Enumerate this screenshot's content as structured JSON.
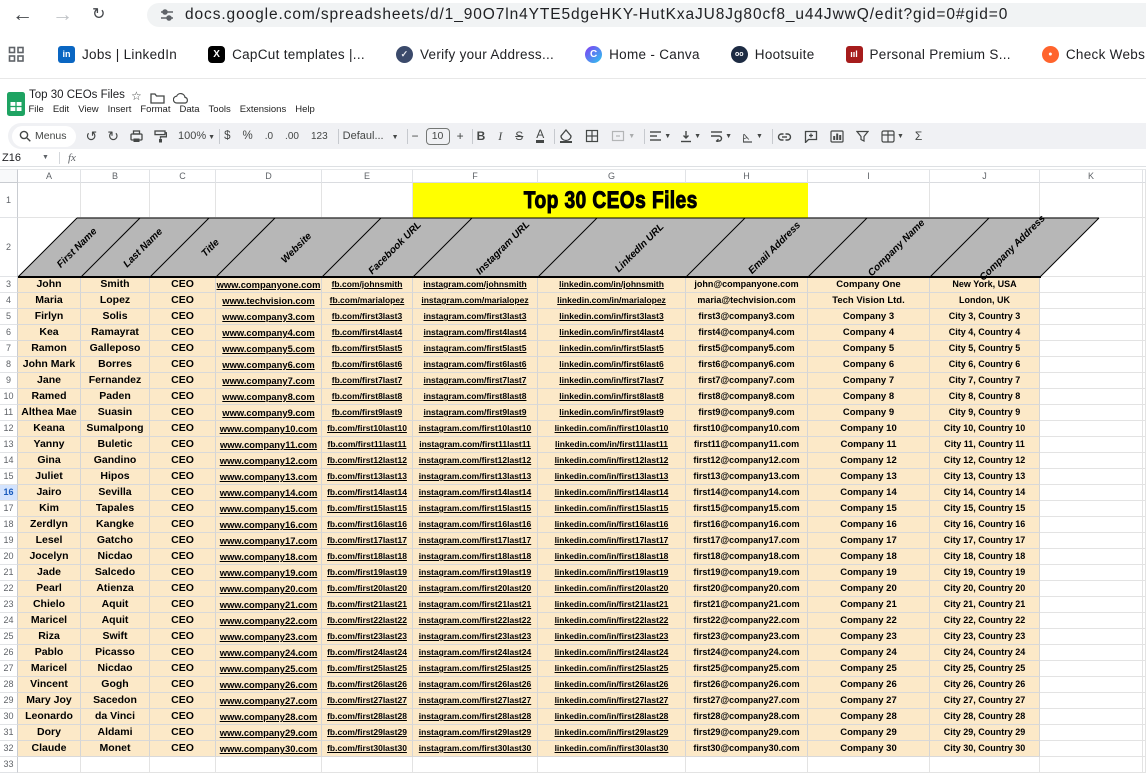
{
  "browser": {
    "url": "docs.google.com/spreadsheets/d/1_90O7ln4YTE5dgeHKY-HutKxaJU8Jg80cf8_u44JwwQ/edit?gid=0#gid=0",
    "bookmarks": [
      {
        "label": "Jobs | LinkedIn",
        "icon": "linkedin-icon",
        "glyph": "in",
        "bg": "#0a66c2",
        "fg": "#ffffff",
        "shape": "3px",
        "fs": "9px"
      },
      {
        "label": "CapCut templates |...",
        "icon": "capcut-icon",
        "glyph": "X",
        "bg": "#000000",
        "fg": "#ffffff",
        "shape": "4px",
        "fs": "10px"
      },
      {
        "label": "Verify your Address...",
        "icon": "verify-icon",
        "glyph": "✓",
        "bg": "#3b4a6b",
        "fg": "#e8eaf0",
        "shape": "50%",
        "fs": "9px"
      },
      {
        "label": "Home - Canva",
        "icon": "canva-icon",
        "glyph": "C",
        "bg": "linear-gradient(135deg,#823af3,#2bc9ee)",
        "fg": "#ffffff",
        "shape": "50%",
        "fs": "10px"
      },
      {
        "label": "Hootsuite",
        "icon": "hootsuite-icon",
        "glyph": "oo",
        "bg": "#1d2b43",
        "fg": "#ffffff",
        "shape": "50%",
        "fs": "7px"
      },
      {
        "label": "Personal Premium S...",
        "icon": "bars-icon",
        "glyph": "ııl",
        "bg": "#a61c1c",
        "fg": "#ffffff",
        "shape": "3px",
        "fs": "9px"
      },
      {
        "label": "Check Webs...",
        "icon": "semrush-icon",
        "glyph": "●",
        "bg": "#ff642d",
        "fg": "#ffffff",
        "shape": "50%",
        "fs": "7px"
      }
    ]
  },
  "sheets": {
    "doc_title": "Top 30 CEOs Files",
    "menu": [
      "File",
      "Edit",
      "View",
      "Insert",
      "Format",
      "Data",
      "Tools",
      "Extensions",
      "Help"
    ],
    "toolbar": {
      "menus": "Menus",
      "zoom": "100%",
      "currency": "$",
      "percent": "%",
      "dec0": ".0",
      "dec00": ".00",
      "n123": "123",
      "font": "Defaul...",
      "minus": "−",
      "size": "10",
      "plus": "+",
      "bold": "B",
      "italic": "I",
      "strike": "S",
      "color": "A",
      "sigma": "Σ"
    },
    "name_box": "Z16",
    "fx": "fx"
  },
  "sheet": {
    "col_letters": [
      "A",
      "B",
      "C",
      "D",
      "E",
      "F",
      "G",
      "H",
      "I",
      "J",
      "K"
    ],
    "row_numbers": [
      1,
      2,
      3,
      4,
      5,
      6,
      7,
      8,
      9,
      10,
      11,
      12,
      13,
      14,
      15,
      16,
      17,
      18,
      19,
      20,
      21,
      22,
      23,
      24,
      25,
      26,
      27,
      28,
      29,
      30,
      31,
      32,
      33
    ],
    "title_cell": "Top 30 CEOs Files",
    "headers": [
      "First Name",
      "Last Name",
      "Title",
      "Website",
      "Facebook URL",
      "Instagram URL",
      "LinkedIn URL",
      "Email Address",
      "Company Name",
      "Company Address"
    ],
    "selected_row": 16,
    "rows": [
      [
        "John",
        "Smith",
        "CEO",
        "www.companyone.com",
        "fb.com/johnsmith",
        "instagram.com/johnsmith",
        "linkedin.com/in/johnsmith",
        "john@companyone.com",
        "Company One",
        "New York, USA"
      ],
      [
        "Maria",
        "Lopez",
        "CEO",
        "www.techvision.com",
        "fb.com/marialopez",
        "instagram.com/marialopez",
        "linkedin.com/in/marialopez",
        "maria@techvision.com",
        "Tech Vision Ltd.",
        "London, UK"
      ],
      [
        "Firlyn",
        "Solis",
        "CEO",
        "www.company3.com",
        "fb.com/first3last3",
        "instagram.com/first3last3",
        "linkedin.com/in/first3last3",
        "first3@company3.com",
        "Company 3",
        "City 3, Country 3"
      ],
      [
        "Kea",
        "Ramayrat",
        "CEO",
        "www.company4.com",
        "fb.com/first4last4",
        "instagram.com/first4last4",
        "linkedin.com/in/first4last4",
        "first4@company4.com",
        "Company 4",
        "City 4, Country 4"
      ],
      [
        "Ramon",
        "Galleposo",
        "CEO",
        "www.company5.com",
        "fb.com/first5last5",
        "instagram.com/first5last5",
        "linkedin.com/in/first5last5",
        "first5@company5.com",
        "Company 5",
        "City 5, Country 5"
      ],
      [
        "John Mark",
        "Borres",
        "CEO",
        "www.company6.com",
        "fb.com/first6last6",
        "instagram.com/first6last6",
        "linkedin.com/in/first6last6",
        "first6@company6.com",
        "Company 6",
        "City 6, Country 6"
      ],
      [
        "Jane",
        "Fernandez",
        "CEO",
        "www.company7.com",
        "fb.com/first7last7",
        "instagram.com/first7last7",
        "linkedin.com/in/first7last7",
        "first7@company7.com",
        "Company 7",
        "City 7, Country 7"
      ],
      [
        "Ramed",
        "Paden",
        "CEO",
        "www.company8.com",
        "fb.com/first8last8",
        "instagram.com/first8last8",
        "linkedin.com/in/first8last8",
        "first8@company8.com",
        "Company 8",
        "City 8, Country 8"
      ],
      [
        "Althea Mae",
        "Suasin",
        "CEO",
        "www.company9.com",
        "fb.com/first9last9",
        "instagram.com/first9last9",
        "linkedin.com/in/first9last9",
        "first9@company9.com",
        "Company 9",
        "City 9, Country 9"
      ],
      [
        "Keana",
        "Sumalpong",
        "CEO",
        "www.company10.com",
        "fb.com/first10last10",
        "instagram.com/first10last10",
        "linkedin.com/in/first10last10",
        "first10@company10.com",
        "Company 10",
        "City 10, Country 10"
      ],
      [
        "Yanny",
        "Buletic",
        "CEO",
        "www.company11.com",
        "fb.com/first11last11",
        "instagram.com/first11last11",
        "linkedin.com/in/first11last11",
        "first11@company11.com",
        "Company 11",
        "City 11, Country 11"
      ],
      [
        "Gina",
        "Gandino",
        "CEO",
        "www.company12.com",
        "fb.com/first12last12",
        "instagram.com/first12last12",
        "linkedin.com/in/first12last12",
        "first12@company12.com",
        "Company 12",
        "City 12, Country 12"
      ],
      [
        "Juliet",
        "Hipos",
        "CEO",
        "www.company13.com",
        "fb.com/first13last13",
        "instagram.com/first13last13",
        "linkedin.com/in/first13last13",
        "first13@company13.com",
        "Company 13",
        "City 13, Country 13"
      ],
      [
        "Jairo",
        "Sevilla",
        "CEO",
        "www.company14.com",
        "fb.com/first14last14",
        "instagram.com/first14last14",
        "linkedin.com/in/first14last14",
        "first14@company14.com",
        "Company 14",
        "City 14, Country 14"
      ],
      [
        "Kim",
        "Tapales",
        "CEO",
        "www.company15.com",
        "fb.com/first15last15",
        "instagram.com/first15last15",
        "linkedin.com/in/first15last15",
        "first15@company15.com",
        "Company 15",
        "City 15, Country 15"
      ],
      [
        "Zerdlyn",
        "Kangke",
        "CEO",
        "www.company16.com",
        "fb.com/first16last16",
        "instagram.com/first16last16",
        "linkedin.com/in/first16last16",
        "first16@company16.com",
        "Company 16",
        "City 16, Country 16"
      ],
      [
        "Lesel",
        "Gatcho",
        "CEO",
        "www.company17.com",
        "fb.com/first17last17",
        "instagram.com/first17last17",
        "linkedin.com/in/first17last17",
        "first17@company17.com",
        "Company 17",
        "City 17, Country 17"
      ],
      [
        "Jocelyn",
        "Nicdao",
        "CEO",
        "www.company18.com",
        "fb.com/first18last18",
        "instagram.com/first18last18",
        "linkedin.com/in/first18last18",
        "first18@company18.com",
        "Company 18",
        "City 18, Country 18"
      ],
      [
        "Jade",
        "Salcedo",
        "CEO",
        "www.company19.com",
        "fb.com/first19last19",
        "instagram.com/first19last19",
        "linkedin.com/in/first19last19",
        "first19@company19.com",
        "Company 19",
        "City 19, Country 19"
      ],
      [
        "Pearl",
        "Atienza",
        "CEO",
        "www.company20.com",
        "fb.com/first20last20",
        "instagram.com/first20last20",
        "linkedin.com/in/first20last20",
        "first20@company20.com",
        "Company 20",
        "City 20, Country 20"
      ],
      [
        "Chielo",
        "Aquit",
        "CEO",
        "www.company21.com",
        "fb.com/first21last21",
        "instagram.com/first21last21",
        "linkedin.com/in/first21last21",
        "first21@company21.com",
        "Company 21",
        "City 21, Country 21"
      ],
      [
        "Maricel",
        "Aquit",
        "CEO",
        "www.company22.com",
        "fb.com/first22last22",
        "instagram.com/first22last22",
        "linkedin.com/in/first22last22",
        "first22@company22.com",
        "Company 22",
        "City 22, Country 22"
      ],
      [
        "Riza",
        "Swift",
        "CEO",
        "www.company23.com",
        "fb.com/first23last23",
        "instagram.com/first23last23",
        "linkedin.com/in/first23last23",
        "first23@company23.com",
        "Company 23",
        "City 23, Country 23"
      ],
      [
        "Pablo",
        "Picasso",
        "CEO",
        "www.company24.com",
        "fb.com/first24last24",
        "instagram.com/first24last24",
        "linkedin.com/in/first24last24",
        "first24@company24.com",
        "Company 24",
        "City 24, Country 24"
      ],
      [
        "Maricel",
        "Nicdao",
        "CEO",
        "www.company25.com",
        "fb.com/first25last25",
        "instagram.com/first25last25",
        "linkedin.com/in/first25last25",
        "first25@company25.com",
        "Company 25",
        "City 25, Country 25"
      ],
      [
        "Vincent",
        "Gogh",
        "CEO",
        "www.company26.com",
        "fb.com/first26last26",
        "instagram.com/first26last26",
        "linkedin.com/in/first26last26",
        "first26@company26.com",
        "Company 26",
        "City 26, Country 26"
      ],
      [
        "Mary Joy",
        "Sacedon",
        "CEO",
        "www.company27.com",
        "fb.com/first27last27",
        "instagram.com/first27last27",
        "linkedin.com/in/first27last27",
        "first27@company27.com",
        "Company 27",
        "City 27, Country 27"
      ],
      [
        "Leonardo",
        "da Vinci",
        "CEO",
        "www.company28.com",
        "fb.com/first28last28",
        "instagram.com/first28last28",
        "linkedin.com/in/first28last28",
        "first28@company28.com",
        "Company 28",
        "City 28, Country 28"
      ],
      [
        "Dory",
        "Aldami",
        "CEO",
        "www.company29.com",
        "fb.com/first29last29",
        "instagram.com/first29last29",
        "linkedin.com/in/first29last29",
        "first29@company29.com",
        "Company 29",
        "City 29, Country 29"
      ],
      [
        "Claude",
        "Monet",
        "CEO",
        "www.company30.com",
        "fb.com/first30last30",
        "instagram.com/first30last30",
        "linkedin.com/in/first30last30",
        "first30@company30.com",
        "Company 30",
        "City 30, Country 30"
      ]
    ]
  }
}
